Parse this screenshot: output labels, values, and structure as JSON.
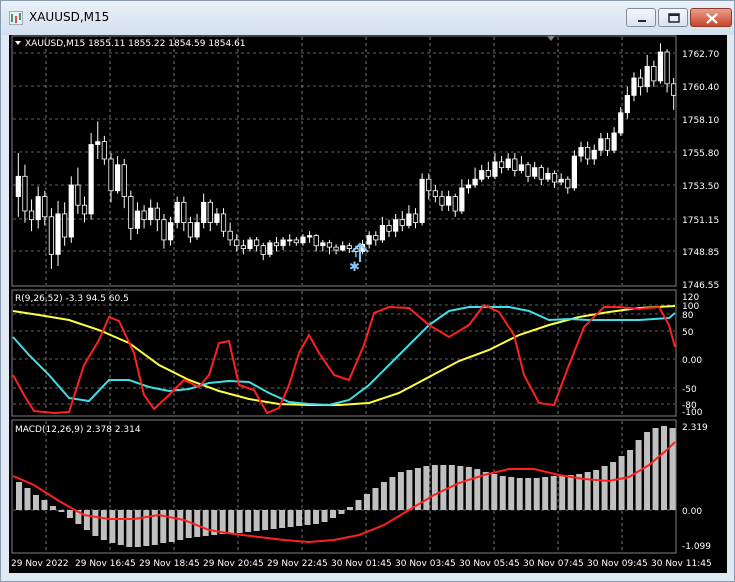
{
  "window": {
    "title": "XAUUSD,M15",
    "minimize_icon": "minimize-icon",
    "maximize_icon": "restore-icon",
    "close_icon": "close-icon"
  },
  "colors": {
    "background": "#000000",
    "grid": "#c0c0c0",
    "bull_candle": "#ffffff",
    "bear_candle": "#000000",
    "rsi_line": "#ff2020",
    "cyan_line": "#40e0e8",
    "yellow_line": "#ffff40",
    "macd_hist": "#c0c0c0",
    "macd_signal": "#ff2020",
    "arrow": "#87c8f0"
  },
  "price_panel": {
    "header": "XAUUSD,M15  1855.11 1855.22 1854.59 1854.61",
    "price_ticks": [
      "1762.70",
      "1760.40",
      "1758.10",
      "1755.80",
      "1753.50",
      "1751.15",
      "1748.85",
      "1746.55"
    ]
  },
  "rsi_panel": {
    "header": "R(9,26,52) -3.3 94.5 60.5",
    "ticks": [
      "120",
      "100",
      "80",
      "50",
      "0.00",
      "-50",
      "-80",
      "-100"
    ]
  },
  "macd_panel": {
    "header": "MACD(12,26,9) 2.378 2.314",
    "ticks": [
      "2.319",
      "0.00",
      "-1.099"
    ]
  },
  "time_axis": [
    "29 Nov 2022",
    "29 Nov 16:45",
    "29 Nov 18:45",
    "29 Nov 20:45",
    "29 Nov 22:45",
    "30 Nov 01:45",
    "30 Nov 03:45",
    "30 Nov 05:45",
    "30 Nov 07:45",
    "30 Nov 09:45",
    "30 Nov 11:45"
  ],
  "chart_data": {
    "type": "candlestick",
    "symbol": "XAUUSD",
    "timeframe": "M15",
    "price_range": [
      1746.55,
      1763.5
    ],
    "candles": [
      [
        1752.6,
        1754.0,
        1755.6,
        1751.2
      ],
      [
        1754.0,
        1751.6,
        1754.8,
        1750.8
      ],
      [
        1751.6,
        1751.0,
        1752.4,
        1750.2
      ],
      [
        1751.0,
        1752.6,
        1753.3,
        1750.4
      ],
      [
        1752.6,
        1751.2,
        1753.0,
        1750.6
      ],
      [
        1751.2,
        1748.6,
        1751.8,
        1747.6
      ],
      [
        1748.6,
        1751.4,
        1752.3,
        1747.8
      ],
      [
        1751.4,
        1749.8,
        1752.2,
        1749.2
      ],
      [
        1749.8,
        1753.4,
        1754.0,
        1749.4
      ],
      [
        1753.4,
        1752.0,
        1754.6,
        1751.4
      ],
      [
        1752.0,
        1751.4,
        1752.6,
        1750.8
      ],
      [
        1751.4,
        1756.2,
        1757.0,
        1751.0
      ],
      [
        1756.2,
        1756.4,
        1757.8,
        1755.2
      ],
      [
        1756.4,
        1755.2,
        1756.8,
        1754.8
      ],
      [
        1755.2,
        1753.0,
        1755.6,
        1752.2
      ],
      [
        1753.0,
        1754.8,
        1755.4,
        1752.8
      ],
      [
        1754.8,
        1752.6,
        1755.2,
        1751.8
      ],
      [
        1752.6,
        1750.4,
        1753.0,
        1749.6
      ],
      [
        1750.4,
        1751.6,
        1752.2,
        1750.0
      ],
      [
        1751.6,
        1751.0,
        1752.0,
        1750.4
      ],
      [
        1751.0,
        1751.8,
        1752.4,
        1750.6
      ],
      [
        1751.8,
        1751.0,
        1752.2,
        1750.2
      ],
      [
        1751.0,
        1749.6,
        1751.4,
        1749.0
      ],
      [
        1749.6,
        1750.8,
        1751.2,
        1749.2
      ],
      [
        1750.8,
        1752.2,
        1752.6,
        1750.4
      ],
      [
        1752.2,
        1750.8,
        1752.6,
        1750.2
      ],
      [
        1750.8,
        1749.8,
        1751.2,
        1749.4
      ],
      [
        1749.8,
        1750.8,
        1751.4,
        1749.6
      ],
      [
        1750.8,
        1752.2,
        1752.8,
        1750.4
      ],
      [
        1752.2,
        1750.8,
        1752.4,
        1750.2
      ],
      [
        1750.8,
        1751.4,
        1751.8,
        1750.6
      ],
      [
        1751.4,
        1750.2,
        1751.8,
        1749.8
      ],
      [
        1750.2,
        1749.6,
        1750.8,
        1749.2
      ],
      [
        1749.6,
        1749.2,
        1750.0,
        1748.8
      ],
      [
        1749.2,
        1749.0,
        1749.6,
        1748.6
      ],
      [
        1749.0,
        1749.6,
        1749.8,
        1748.8
      ],
      [
        1749.6,
        1749.2,
        1749.8,
        1748.8
      ],
      [
        1749.2,
        1748.6,
        1749.4,
        1748.2
      ],
      [
        1748.6,
        1749.4,
        1749.6,
        1748.4
      ],
      [
        1749.4,
        1749.2,
        1749.8,
        1748.8
      ],
      [
        1749.2,
        1749.6,
        1749.8,
        1748.9
      ],
      [
        1749.6,
        1749.6,
        1750.0,
        1749.2
      ],
      [
        1749.6,
        1749.4,
        1749.8,
        1749.2
      ],
      [
        1749.4,
        1749.8,
        1750.0,
        1749.2
      ],
      [
        1749.8,
        1749.9,
        1750.2,
        1749.4
      ],
      [
        1749.9,
        1749.2,
        1750.0,
        1748.8
      ],
      [
        1749.2,
        1749.4,
        1749.6,
        1748.8
      ],
      [
        1749.4,
        1749.1,
        1749.6,
        1748.6
      ],
      [
        1749.1,
        1748.9,
        1749.3,
        1748.6
      ],
      [
        1748.9,
        1749.2,
        1749.5,
        1748.8
      ],
      [
        1749.2,
        1749.0,
        1749.4,
        1748.7
      ],
      [
        1749.0,
        1748.8,
        1749.2,
        1748.4
      ],
      [
        1748.8,
        1749.3,
        1749.6,
        1748.6
      ],
      [
        1749.3,
        1749.9,
        1750.2,
        1749.0
      ],
      [
        1749.9,
        1749.6,
        1750.2,
        1749.2
      ],
      [
        1749.6,
        1750.6,
        1751.2,
        1749.4
      ],
      [
        1750.6,
        1750.2,
        1751.0,
        1749.8
      ],
      [
        1750.2,
        1751.0,
        1751.4,
        1749.8
      ],
      [
        1751.0,
        1750.6,
        1751.6,
        1750.2
      ],
      [
        1750.6,
        1751.4,
        1752.0,
        1750.4
      ],
      [
        1751.4,
        1750.8,
        1751.8,
        1750.4
      ],
      [
        1750.8,
        1753.8,
        1754.2,
        1750.6
      ],
      [
        1753.8,
        1753.0,
        1754.2,
        1752.4
      ],
      [
        1753.0,
        1752.6,
        1753.4,
        1752.2
      ],
      [
        1752.6,
        1752.0,
        1753.0,
        1751.6
      ],
      [
        1752.0,
        1752.6,
        1753.0,
        1751.6
      ],
      [
        1752.6,
        1751.6,
        1752.8,
        1751.2
      ],
      [
        1751.6,
        1753.2,
        1753.8,
        1751.4
      ],
      [
        1753.2,
        1753.4,
        1753.8,
        1752.8
      ],
      [
        1753.4,
        1753.8,
        1754.6,
        1753.2
      ],
      [
        1753.8,
        1754.4,
        1754.8,
        1753.6
      ],
      [
        1754.4,
        1754.0,
        1755.0,
        1753.8
      ],
      [
        1754.0,
        1755.0,
        1755.6,
        1753.8
      ],
      [
        1755.0,
        1754.6,
        1755.4,
        1754.2
      ],
      [
        1754.6,
        1755.2,
        1755.6,
        1754.4
      ],
      [
        1755.2,
        1754.4,
        1755.6,
        1754.0
      ],
      [
        1754.4,
        1754.8,
        1755.4,
        1754.2
      ],
      [
        1754.8,
        1754.0,
        1755.0,
        1753.6
      ],
      [
        1754.0,
        1754.6,
        1755.0,
        1753.8
      ],
      [
        1754.6,
        1753.8,
        1754.8,
        1753.4
      ],
      [
        1753.8,
        1754.2,
        1754.6,
        1753.6
      ],
      [
        1754.2,
        1753.6,
        1754.4,
        1753.2
      ],
      [
        1753.6,
        1753.8,
        1754.2,
        1753.4
      ],
      [
        1753.8,
        1753.2,
        1754.0,
        1752.8
      ],
      [
        1753.2,
        1755.4,
        1755.8,
        1753.0
      ],
      [
        1755.4,
        1756.0,
        1756.4,
        1755.0
      ],
      [
        1756.0,
        1755.2,
        1756.4,
        1754.8
      ],
      [
        1755.2,
        1755.8,
        1756.2,
        1754.8
      ],
      [
        1755.8,
        1756.6,
        1757.0,
        1755.4
      ],
      [
        1756.6,
        1755.8,
        1757.0,
        1755.4
      ],
      [
        1755.8,
        1757.0,
        1757.4,
        1755.6
      ],
      [
        1757.0,
        1758.4,
        1758.8,
        1756.8
      ],
      [
        1758.4,
        1759.6,
        1760.2,
        1758.0
      ],
      [
        1759.6,
        1760.8,
        1761.2,
        1759.2
      ],
      [
        1760.8,
        1760.2,
        1761.4,
        1759.6
      ],
      [
        1760.2,
        1761.6,
        1762.4,
        1759.8
      ],
      [
        1761.6,
        1760.6,
        1762.0,
        1760.2
      ],
      [
        1760.6,
        1762.6,
        1763.2,
        1760.4
      ],
      [
        1762.6,
        1760.4,
        1762.8,
        1759.8
      ],
      [
        1760.4,
        1759.6,
        1760.8,
        1758.6
      ]
    ],
    "signal_arrow": "up-arrow-at-30-Nov-01:15"
  }
}
